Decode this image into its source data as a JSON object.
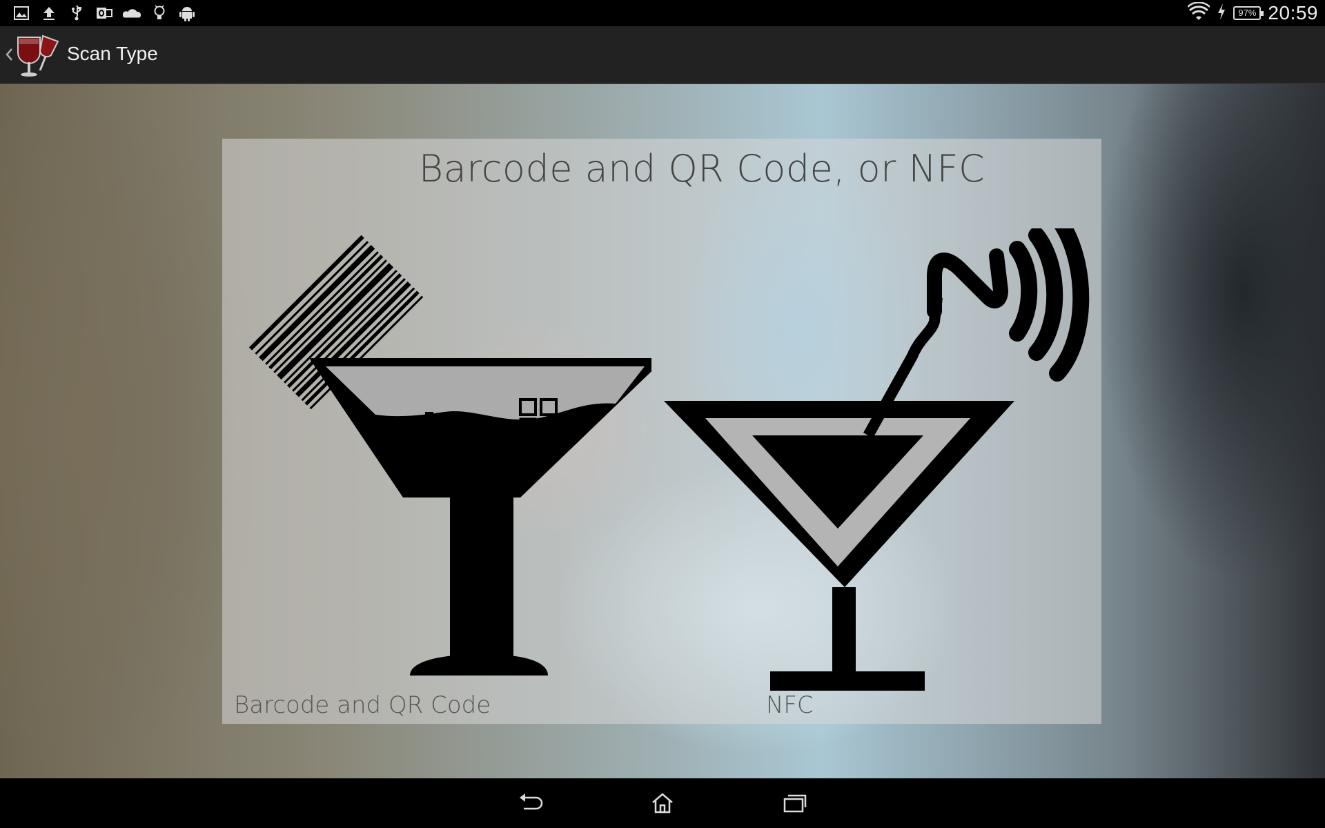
{
  "status_bar": {
    "notification_icons": [
      "gallery-icon",
      "upload-icon",
      "usb-icon",
      "outlook-icon",
      "cloud-icon",
      "lightbulb-icon",
      "android-icon"
    ],
    "wifi": "wifi-icon",
    "charging": "charging-icon",
    "battery_percent": "97%",
    "time": "20:59"
  },
  "action_bar": {
    "title": "Scan Type",
    "app_icon": "wine-glasses-icon"
  },
  "panel": {
    "title": "Barcode and QR Code, or NFC",
    "options": [
      {
        "label": "Barcode and QR Code",
        "icon": "barcode-cocktail-icon"
      },
      {
        "label": "NFC",
        "icon": "nfc-cocktail-icon"
      }
    ]
  },
  "nav_bar": {
    "buttons": [
      "back-icon",
      "home-icon",
      "recent-apps-icon"
    ]
  },
  "colors": {
    "status_bar": "#000000",
    "action_bar": "#222222",
    "title_text": "#f2f2f2",
    "panel_text": "#444444"
  }
}
